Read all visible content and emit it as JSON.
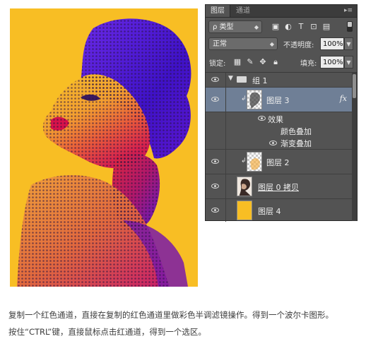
{
  "panel": {
    "tabs": [
      "图层",
      "通道"
    ],
    "active_tab": "图层",
    "filter": {
      "label": "类型"
    },
    "blend_mode": "正常",
    "opacity": {
      "label": "不透明度:",
      "value": "100%"
    },
    "lock": {
      "label": "锁定:"
    },
    "fill": {
      "label": "填充:",
      "value": "100%"
    },
    "layers": {
      "group": {
        "name": "组 1"
      },
      "layer3": {
        "name": "图层 3",
        "fx": "fx"
      },
      "effects": {
        "header": "效果",
        "color_overlay": "颜色叠加",
        "gradient_overlay": "渐变叠加"
      },
      "layer2": {
        "name": "图层 2"
      },
      "layer0copy": {
        "name": "图层 0 拷贝"
      },
      "layer4": {
        "name": "图层 4"
      }
    }
  },
  "caption": {
    "line1": "复制一个红色通道，直接在复制的红色通道里做彩色半调滤镜操作。得到一个波尔卡图形。",
    "line2": "按住“CTRL”键，直接鼠标点击红通道，得到一个选区。"
  },
  "colors": {
    "artwork_background": "#f8be24",
    "halftone_blue": "#4a1bd9",
    "halftone_magenta": "#e2154f",
    "panel_bg": "#535353",
    "selected_row": "#6f7f96",
    "layer4_fill": "#f8be24"
  },
  "icons": {
    "visibility": "eye-icon",
    "group": "folder-icon",
    "clip": "clipping-arrow-icon",
    "panel_menu": "panel-menu-icon"
  }
}
